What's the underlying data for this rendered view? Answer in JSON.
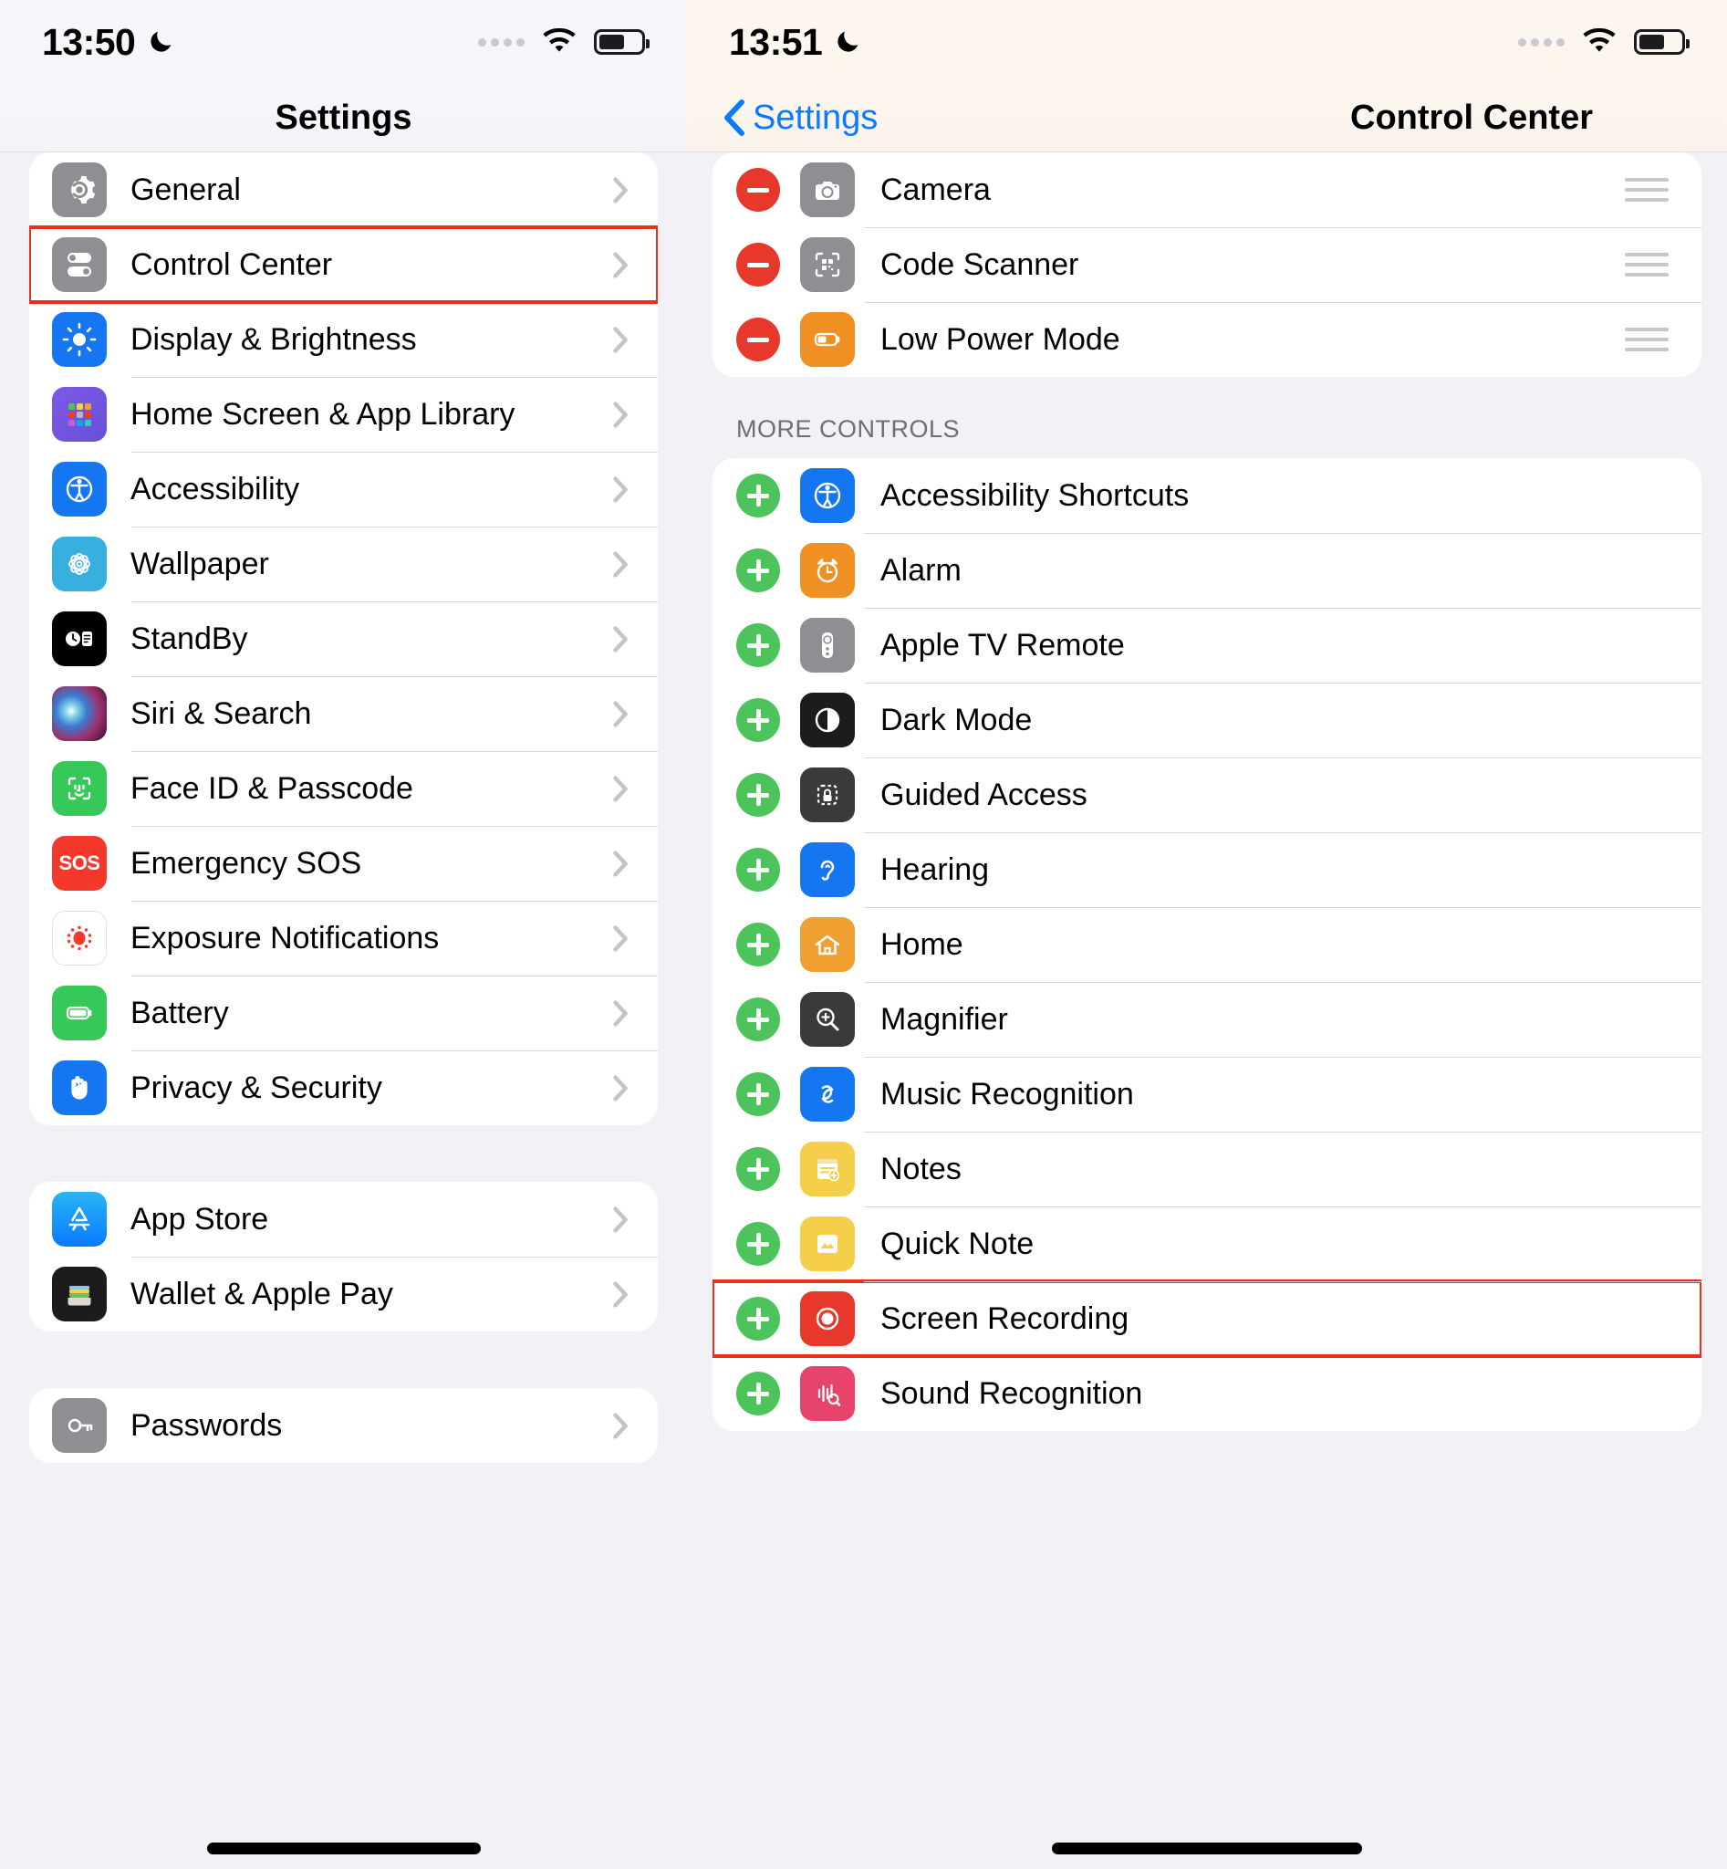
{
  "left_screen": {
    "status_bar": {
      "time": "13:50",
      "dnd_icon": "moon-icon",
      "wifi_icon": "wifi-icon",
      "battery_icon": "battery-icon",
      "cellular_icon": "cellular-dots-icon"
    },
    "nav": {
      "title": "Settings"
    },
    "group1": [
      {
        "label": "General",
        "icon": "gear-icon",
        "icon_color": "#8e8e93"
      },
      {
        "label": "Control Center",
        "icon": "control-center-icon",
        "icon_color": "#8e8e93",
        "highlighted": true
      },
      {
        "label": "Display & Brightness",
        "icon": "brightness-icon",
        "icon_color": "#1476f0"
      },
      {
        "label": "Home Screen & App Library",
        "icon": "app-grid-icon",
        "icon_color": "#6a5ae0"
      },
      {
        "label": "Accessibility",
        "icon": "accessibility-icon",
        "icon_color": "#1476f0"
      },
      {
        "label": "Wallpaper",
        "icon": "wallpaper-flower-icon",
        "icon_color": "#37b0e0"
      },
      {
        "label": "StandBy",
        "icon": "standby-icon",
        "icon_color": "#000000"
      },
      {
        "label": "Siri & Search",
        "icon": "siri-icon",
        "icon_color": "#2b1a2e"
      },
      {
        "label": "Face ID & Passcode",
        "icon": "face-id-icon",
        "icon_color": "#37c85a"
      },
      {
        "label": "Emergency SOS",
        "icon": "sos-icon",
        "icon_color": "#f5382c"
      },
      {
        "label": "Exposure Notifications",
        "icon": "exposure-notifications-icon",
        "icon_color": "#ffffff"
      },
      {
        "label": "Battery",
        "icon": "battery-green-icon",
        "icon_color": "#37c85a"
      },
      {
        "label": "Privacy & Security",
        "icon": "hand-privacy-icon",
        "icon_color": "#1476f0"
      }
    ],
    "group2": [
      {
        "label": "App Store",
        "icon": "app-store-icon",
        "icon_color": "#1a9ff0"
      },
      {
        "label": "Wallet & Apple Pay",
        "icon": "wallet-icon",
        "icon_color": "#1c1c1e"
      }
    ],
    "group3": [
      {
        "label": "Passwords",
        "icon": "passwords-icon",
        "icon_color": "#8e8e93"
      }
    ]
  },
  "right_screen": {
    "status_bar": {
      "time": "13:51",
      "dnd_icon": "moon-icon",
      "wifi_icon": "wifi-icon",
      "battery_icon": "battery-icon",
      "cellular_icon": "cellular-dots-icon"
    },
    "nav": {
      "back_label": "Settings",
      "title": "Control Center",
      "back_icon": "chevron-left-icon"
    },
    "included_controls": [
      {
        "label": "Camera",
        "icon": "camera-icon",
        "icon_color": "#8e8e93",
        "action": "remove"
      },
      {
        "label": "Code Scanner",
        "icon": "qr-code-icon",
        "icon_color": "#8e8e93",
        "action": "remove"
      },
      {
        "label": "Low Power Mode",
        "icon": "low-power-icon",
        "icon_color": "#f09022",
        "action": "remove"
      }
    ],
    "more_controls_header": "MORE CONTROLS",
    "more_controls": [
      {
        "label": "Accessibility Shortcuts",
        "icon": "accessibility-icon",
        "icon_color": "#1476f0",
        "action": "add"
      },
      {
        "label": "Alarm",
        "icon": "alarm-clock-icon",
        "icon_color": "#f09022",
        "action": "add"
      },
      {
        "label": "Apple TV Remote",
        "icon": "tv-remote-icon",
        "icon_color": "#8e8e93",
        "action": "add"
      },
      {
        "label": "Dark Mode",
        "icon": "dark-mode-icon",
        "icon_color": "#1c1c1e",
        "action": "add"
      },
      {
        "label": "Guided Access",
        "icon": "guided-access-icon",
        "icon_color": "#3a3a3c",
        "action": "add"
      },
      {
        "label": "Hearing",
        "icon": "hearing-ear-icon",
        "icon_color": "#1476f0",
        "action": "add"
      },
      {
        "label": "Home",
        "icon": "home-icon",
        "icon_color": "#f0a030",
        "action": "add"
      },
      {
        "label": "Magnifier",
        "icon": "magnifier-icon",
        "icon_color": "#3a3a3c",
        "action": "add"
      },
      {
        "label": "Music Recognition",
        "icon": "shazam-icon",
        "icon_color": "#1476f0",
        "action": "add"
      },
      {
        "label": "Notes",
        "icon": "notes-icon",
        "icon_color": "#f5cf4a",
        "action": "add"
      },
      {
        "label": "Quick Note",
        "icon": "quick-note-icon",
        "icon_color": "#f5cf4a",
        "action": "add"
      },
      {
        "label": "Screen Recording",
        "icon": "screen-recording-icon",
        "icon_color": "#e8382c",
        "action": "add",
        "highlighted": true
      },
      {
        "label": "Sound Recognition",
        "icon": "sound-recognition-icon",
        "icon_color": "#e8436a",
        "action": "add"
      }
    ]
  },
  "colors": {
    "accent": "#0a7aff",
    "highlight": "#e8301b",
    "add": "#4cc35b",
    "remove": "#e8382c"
  }
}
